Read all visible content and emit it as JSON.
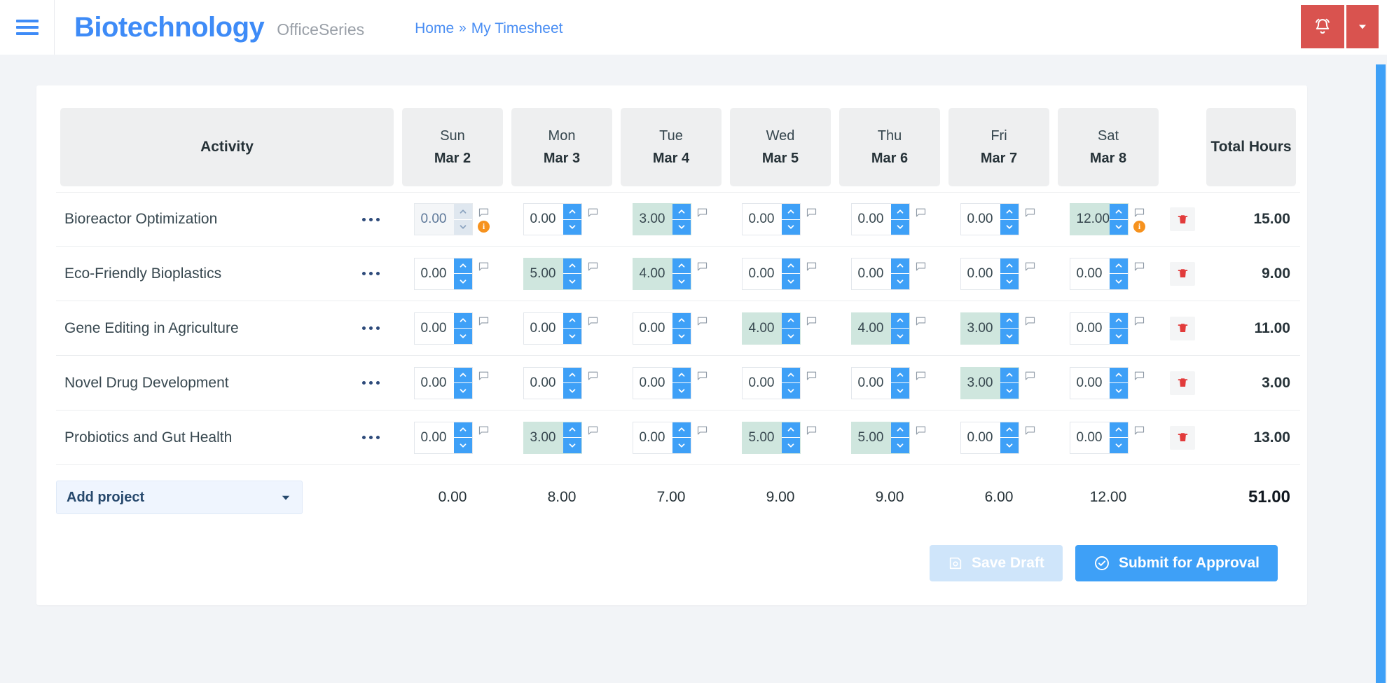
{
  "topbar": {
    "menu_icon": "hamburger-icon",
    "brand": "Biotechnology",
    "brand_suffix": "OfficeSeries",
    "breadcrumb": {
      "home": "Home",
      "separator": "»",
      "current": "My Timesheet"
    },
    "alarm_icon": "alarm-bell-icon",
    "caret_icon": "chevron-down-icon",
    "accent_color": "#3e8bf7",
    "alert_color": "#d9534f"
  },
  "table": {
    "activity_header": "Activity",
    "total_header": "Total Hours",
    "days": [
      {
        "name": "Sun",
        "date": "Mar 2"
      },
      {
        "name": "Mon",
        "date": "Mar 3"
      },
      {
        "name": "Tue",
        "date": "Mar 4"
      },
      {
        "name": "Wed",
        "date": "Mar 5"
      },
      {
        "name": "Thu",
        "date": "Mar 6"
      },
      {
        "name": "Fri",
        "date": "Mar 7"
      },
      {
        "name": "Sat",
        "date": "Mar 8"
      }
    ],
    "rows": [
      {
        "activity": "Bioreactor Optimization",
        "total": "15.00",
        "cells": [
          {
            "value": "0.00",
            "state": "disabled",
            "info": true,
            "comment": true
          },
          {
            "value": "0.00",
            "state": "empty",
            "info": false,
            "comment": true
          },
          {
            "value": "3.00",
            "state": "filled",
            "info": false,
            "comment": true
          },
          {
            "value": "0.00",
            "state": "empty",
            "info": false,
            "comment": true
          },
          {
            "value": "0.00",
            "state": "empty",
            "info": false,
            "comment": true
          },
          {
            "value": "0.00",
            "state": "empty",
            "info": false,
            "comment": true
          },
          {
            "value": "12.00",
            "state": "filled",
            "info": true,
            "comment": true
          }
        ]
      },
      {
        "activity": "Eco-Friendly Bioplastics",
        "total": "9.00",
        "cells": [
          {
            "value": "0.00",
            "state": "empty",
            "info": false,
            "comment": true
          },
          {
            "value": "5.00",
            "state": "filled",
            "info": false,
            "comment": true
          },
          {
            "value": "4.00",
            "state": "filled",
            "info": false,
            "comment": true
          },
          {
            "value": "0.00",
            "state": "empty",
            "info": false,
            "comment": true
          },
          {
            "value": "0.00",
            "state": "empty",
            "info": false,
            "comment": true
          },
          {
            "value": "0.00",
            "state": "empty",
            "info": false,
            "comment": true
          },
          {
            "value": "0.00",
            "state": "empty",
            "info": false,
            "comment": true
          }
        ]
      },
      {
        "activity": "Gene Editing in Agriculture",
        "total": "11.00",
        "cells": [
          {
            "value": "0.00",
            "state": "empty",
            "info": false,
            "comment": true
          },
          {
            "value": "0.00",
            "state": "empty",
            "info": false,
            "comment": true
          },
          {
            "value": "0.00",
            "state": "empty",
            "info": false,
            "comment": true
          },
          {
            "value": "4.00",
            "state": "filled",
            "info": false,
            "comment": true
          },
          {
            "value": "4.00",
            "state": "filled",
            "info": false,
            "comment": true
          },
          {
            "value": "3.00",
            "state": "filled",
            "info": false,
            "comment": true
          },
          {
            "value": "0.00",
            "state": "empty",
            "info": false,
            "comment": true
          }
        ]
      },
      {
        "activity": "Novel Drug Development",
        "total": "3.00",
        "cells": [
          {
            "value": "0.00",
            "state": "empty",
            "info": false,
            "comment": true
          },
          {
            "value": "0.00",
            "state": "empty",
            "info": false,
            "comment": true
          },
          {
            "value": "0.00",
            "state": "empty",
            "info": false,
            "comment": true
          },
          {
            "value": "0.00",
            "state": "empty",
            "info": false,
            "comment": true
          },
          {
            "value": "0.00",
            "state": "empty",
            "info": false,
            "comment": true
          },
          {
            "value": "3.00",
            "state": "filled",
            "info": false,
            "comment": true
          },
          {
            "value": "0.00",
            "state": "empty",
            "info": false,
            "comment": true
          }
        ]
      },
      {
        "activity": "Probiotics and Gut Health",
        "total": "13.00",
        "cells": [
          {
            "value": "0.00",
            "state": "empty",
            "info": false,
            "comment": true
          },
          {
            "value": "3.00",
            "state": "filled",
            "info": false,
            "comment": true
          },
          {
            "value": "0.00",
            "state": "empty",
            "info": false,
            "comment": true
          },
          {
            "value": "5.00",
            "state": "filled",
            "info": false,
            "comment": true
          },
          {
            "value": "5.00",
            "state": "filled",
            "info": false,
            "comment": true
          },
          {
            "value": "0.00",
            "state": "empty",
            "info": false,
            "comment": true
          },
          {
            "value": "0.00",
            "state": "empty",
            "info": false,
            "comment": true
          }
        ]
      }
    ],
    "footer": {
      "add_project_label": "Add project",
      "day_totals": [
        "0.00",
        "8.00",
        "7.00",
        "9.00",
        "9.00",
        "6.00",
        "12.00"
      ],
      "grand_total": "51.00"
    }
  },
  "actions": {
    "save_draft": "Save Draft",
    "submit": "Submit for Approval"
  }
}
